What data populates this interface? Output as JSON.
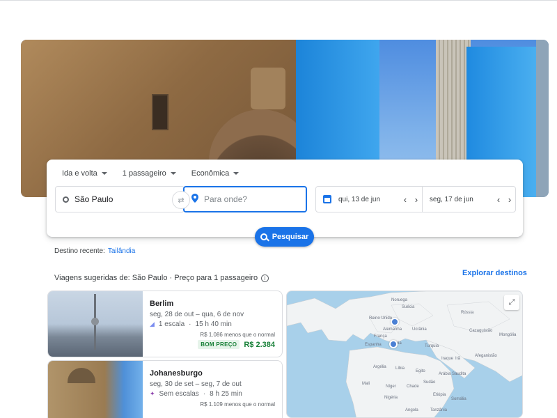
{
  "search": {
    "trip_type": "Ida e volta",
    "passengers": "1 passageiro",
    "cabin": "Econômica",
    "origin": "São Paulo",
    "destination_placeholder": "Para onde?",
    "depart_date": "qui, 13 de jun",
    "return_date": "seg, 17 de jun",
    "button_label": "Pesquisar"
  },
  "recent": {
    "label": "Destino recente:",
    "destination": "Tailândia"
  },
  "suggestions": {
    "title": "Viagens sugeridas de: São Paulo · Preço para 1 passageiro",
    "explore_link": "Explorar destinos",
    "items": [
      {
        "city": "Berlim",
        "dates": "seg, 28 de out – qua, 6 de nov",
        "stops": "1 escala",
        "duration": "15 h 40 min",
        "savings": "R$ 1.086 menos que o normal",
        "badge": "BOM PREÇO",
        "price": "R$ 2.384"
      },
      {
        "city": "Johanesburgo",
        "dates": "seg, 30 de set – seg, 7 de out",
        "stops": "Sem escalas",
        "duration": "8 h 25 min",
        "savings": "R$ 1.109 menos que o normal"
      }
    ]
  },
  "map": {
    "labels": [
      "Noruega",
      "Suécia",
      "Reino Unido",
      "Alemanha",
      "Ucrânia",
      "França",
      "Rússia",
      "Espanha",
      "Itália",
      "Turquia",
      "Cazaquistão",
      "Mongólia",
      "Argélia",
      "Líbia",
      "Egito",
      "Iraque",
      "Irã",
      "Afeganistão",
      "Mali",
      "Níger",
      "Chade",
      "Sudão",
      "Arábia Saudita",
      "Nigéria",
      "Etiópia",
      "Somália",
      "Angola",
      "Tanzânia"
    ]
  },
  "colors": {
    "accent": "#1a73e8",
    "good_price": "#188038"
  }
}
